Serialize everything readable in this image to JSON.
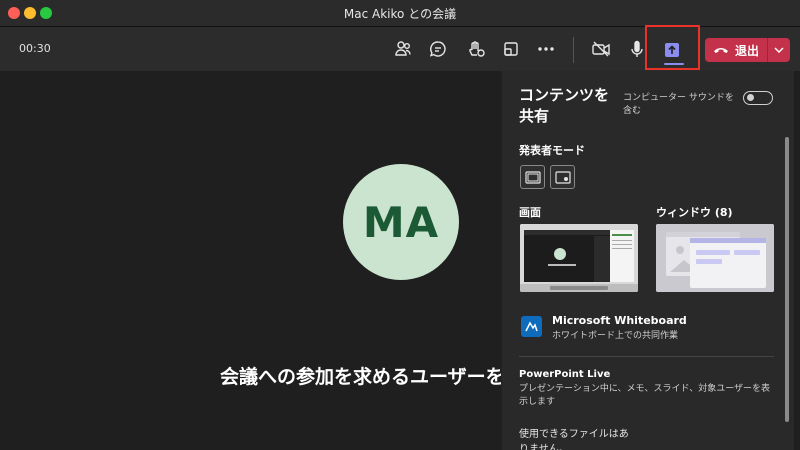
{
  "window": {
    "title": "Mac Akiko との会議"
  },
  "toolbar": {
    "timer": "00:30",
    "leave_label": "退出",
    "icons": [
      "people-icon",
      "chat-icon",
      "reactions-icon",
      "rooms-icon",
      "more-icon",
      "camera-off-icon",
      "mic-icon",
      "share-icon",
      "phone-icon",
      "chevron-down-icon"
    ]
  },
  "stage": {
    "avatar_initials": "MA",
    "invite_text": "会議への参加を求めるユーザーを招"
  },
  "panel": {
    "title": "コンテンツを共有",
    "computer_sound_label": "コンピューター サウンドを含む",
    "computer_sound_on": false,
    "presenter_mode_label": "発表者モード",
    "screen_label": "画面",
    "window_label": "ウィンドウ (8)",
    "whiteboard": {
      "title": "Microsoft Whiteboard",
      "subtitle": "ホワイトボード上での共同作業"
    },
    "powerpoint": {
      "title": "PowerPoint Live",
      "description": "プレゼンテーション中に、メモ、スライド、対象ユーザーを表示します"
    },
    "files_text": "使用できるファイルはありません。"
  },
  "colors": {
    "accent": "#8b8cf0",
    "leave": "#c4314b",
    "highlight": "#e8322a",
    "avatar_bg": "#cbe4d0",
    "avatar_fg": "#1c5a36"
  }
}
